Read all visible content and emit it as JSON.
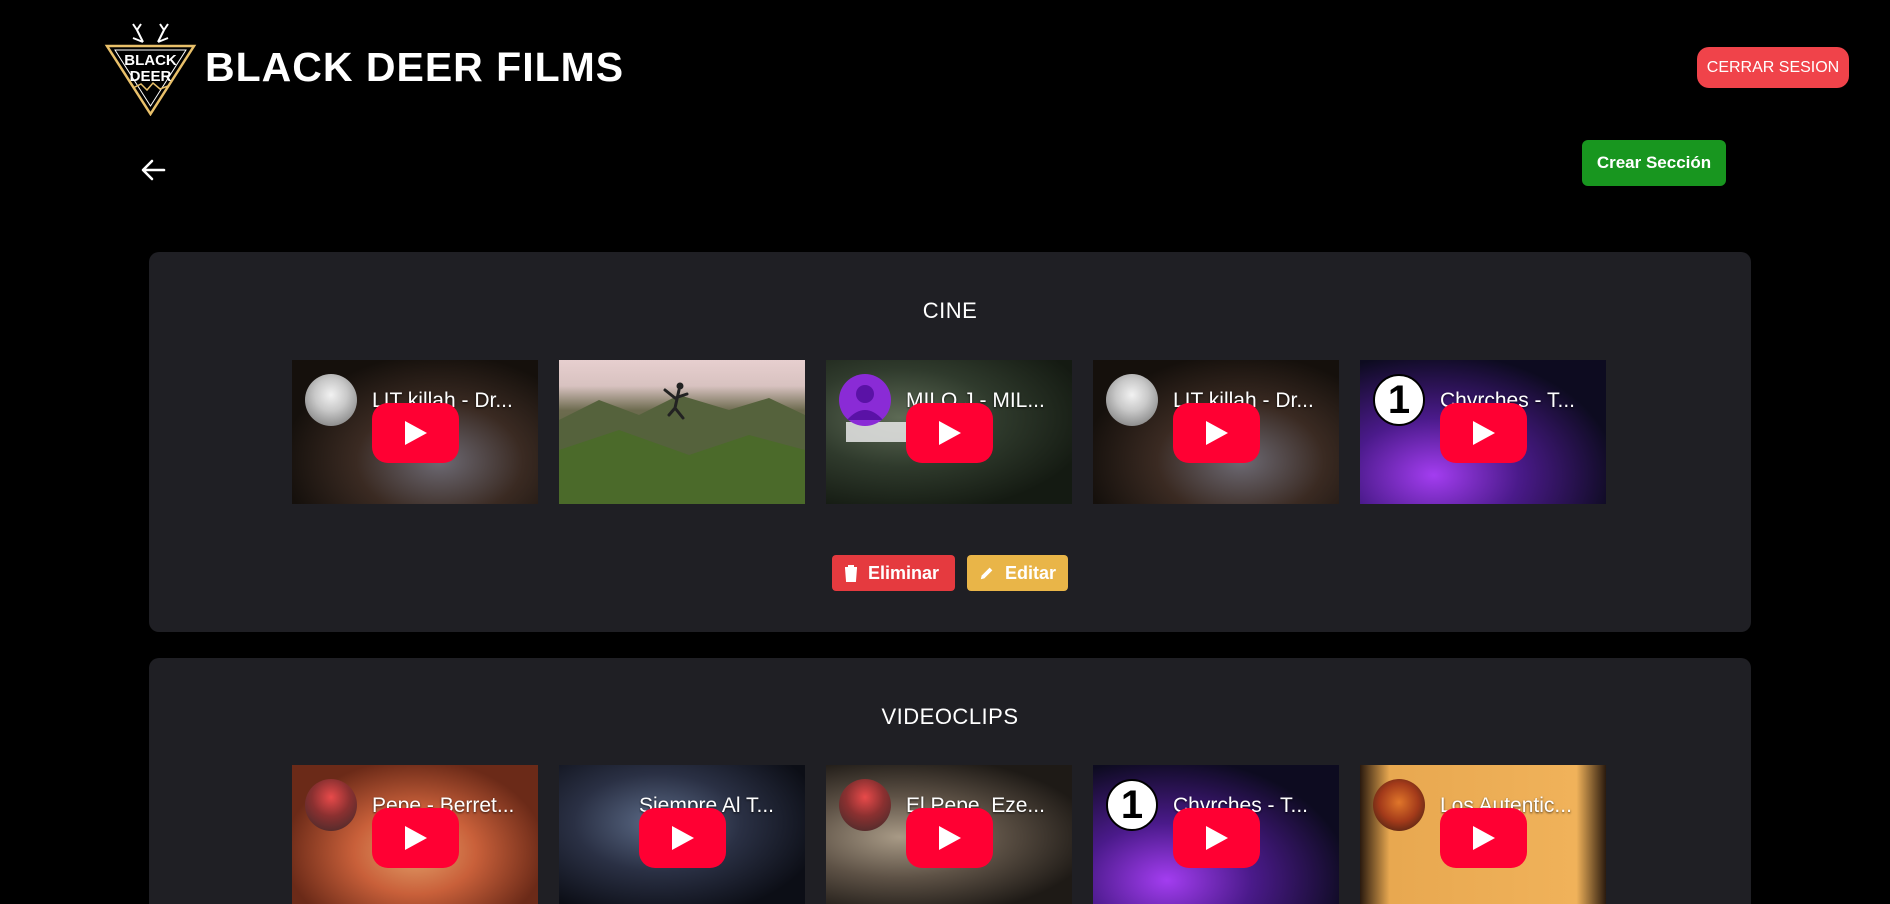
{
  "header": {
    "brand_title": "BLACK DEER FILMS",
    "logo_text_top": "BLACK",
    "logo_text_bottom": "DEER",
    "logout_label": "CERRAR SESION"
  },
  "toolbar": {
    "back_icon": "arrow-left-icon",
    "create_section_label": "Crear Sección"
  },
  "colors": {
    "background": "#000000",
    "card": "#1f1f24",
    "logout": "#f0434a",
    "create": "#18961f",
    "delete": "#e53a3f",
    "edit": "#e9b548",
    "youtube_red": "#ff0033"
  },
  "sections": [
    {
      "title": "CINE",
      "videos": [
        {
          "title": "LIT killah - Dr...",
          "type": "youtube",
          "avatar": "photo"
        },
        {
          "title": "",
          "type": "image"
        },
        {
          "title": "MILO J - MIL...",
          "type": "youtube",
          "avatar": "default"
        },
        {
          "title": "LIT killah - Dr...",
          "type": "youtube",
          "avatar": "photo"
        },
        {
          "title": "Chvrches - T...",
          "type": "youtube",
          "avatar": "1"
        }
      ],
      "delete_label": "Eliminar",
      "edit_label": "Editar"
    },
    {
      "title": "VIDEOCLIPS",
      "videos": [
        {
          "title": "Pepe - Berret...",
          "type": "youtube",
          "avatar": "photo"
        },
        {
          "title": "Siempre Al T...",
          "type": "youtube",
          "avatar": "none"
        },
        {
          "title": "El Pepe, Eze...",
          "type": "youtube",
          "avatar": "photo"
        },
        {
          "title": "Chvrches - T...",
          "type": "youtube",
          "avatar": "1"
        },
        {
          "title": "Los Autentic...",
          "type": "youtube",
          "avatar": "photo"
        }
      ]
    }
  ]
}
